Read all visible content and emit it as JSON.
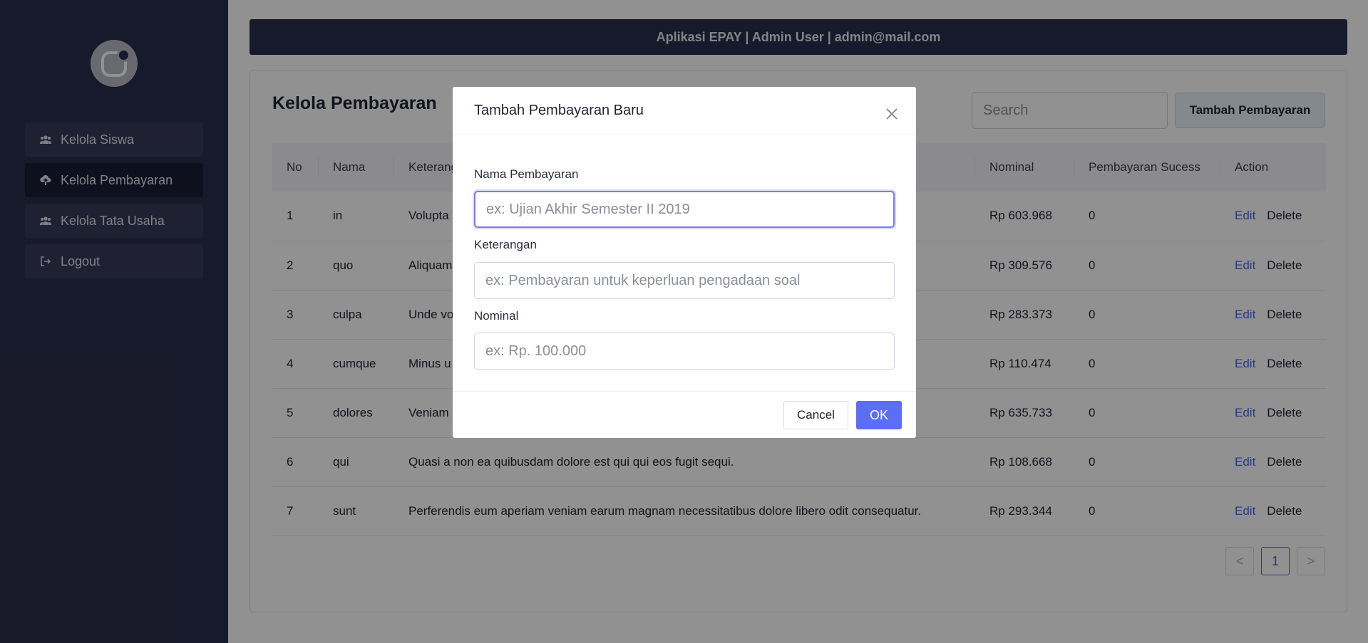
{
  "header": {
    "text": "Aplikasi EPAY | Admin User | admin@mail.com"
  },
  "sidebar": {
    "items": [
      {
        "label": "Kelola Siswa",
        "icon": "users-icon"
      },
      {
        "label": "Kelola Pembayaran",
        "icon": "cloud-upload-icon",
        "active": true
      },
      {
        "label": "Kelola Tata Usaha",
        "icon": "users-icon"
      },
      {
        "label": "Logout",
        "icon": "logout-icon"
      }
    ]
  },
  "page": {
    "title": "Kelola Pembayaran",
    "search_placeholder": "Search",
    "add_button": "Tambah Pembayaran"
  },
  "table": {
    "columns": [
      "No",
      "Nama",
      "Keterangan",
      "Nominal",
      "Pembayaran Sucess",
      "Action"
    ],
    "rows": [
      {
        "no": "1",
        "nama": "in",
        "keterangan": "Volupta",
        "nominal": "Rp 603.968",
        "sukses": "0"
      },
      {
        "no": "2",
        "nama": "quo",
        "keterangan": "Aliquam",
        "nominal": "Rp 309.576",
        "sukses": "0"
      },
      {
        "no": "3",
        "nama": "culpa",
        "keterangan": "Unde vo",
        "nominal": "Rp 283.373",
        "sukses": "0"
      },
      {
        "no": "4",
        "nama": "cumque",
        "keterangan": "Minus u",
        "nominal": "Rp 110.474",
        "sukses": "0"
      },
      {
        "no": "5",
        "nama": "dolores",
        "keterangan": "Veniam",
        "nominal": "Rp 635.733",
        "sukses": "0"
      },
      {
        "no": "6",
        "nama": "qui",
        "keterangan": "Quasi a non ea quibusdam dolore est qui qui eos fugit sequi.",
        "nominal": "Rp 108.668",
        "sukses": "0"
      },
      {
        "no": "7",
        "nama": "sunt",
        "keterangan": "Perferendis eum aperiam veniam earum magnam necessitatibus dolore libero odit consequatur.",
        "nominal": "Rp 293.344",
        "sukses": "0"
      }
    ],
    "edit_label": "Edit",
    "delete_label": "Delete"
  },
  "pagination": {
    "prev": "<",
    "current": "1",
    "next": ">"
  },
  "modal": {
    "title": "Tambah Pembayaran Baru",
    "nama_label": "Nama Pembayaran",
    "nama_placeholder": "ex: Ujian Akhir Semester II 2019",
    "keterangan_label": "Keterangan",
    "keterangan_placeholder": "ex: Pembayaran untuk keperluan pengadaan soal",
    "nominal_label": "Nominal",
    "nominal_placeholder": "ex: Rp. 100.000",
    "cancel": "Cancel",
    "ok": "OK"
  },
  "colors": {
    "sidebar": "#2a2e4a",
    "accent": "#5c6ef8",
    "link": "#4a63e7"
  }
}
